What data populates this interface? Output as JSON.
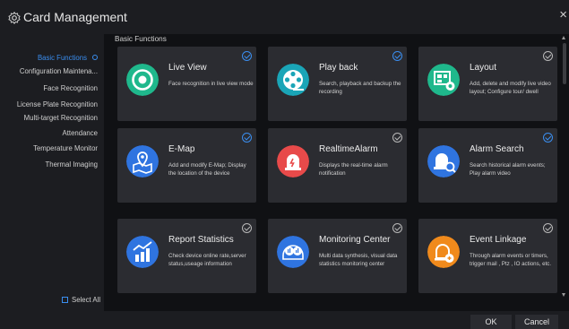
{
  "window": {
    "title": "Card Management",
    "close_symbol": "×"
  },
  "section": {
    "title": "Basic Functions"
  },
  "sidebar": {
    "items": [
      {
        "label": "Basic Functions",
        "active": true
      },
      {
        "label": "Configuration Maintena...",
        "active": false
      },
      {
        "label": "Face Recognition",
        "active": false
      },
      {
        "label": "License Plate Recognition",
        "active": false
      },
      {
        "label": "Multi-target Recognition",
        "active": false
      },
      {
        "label": "Attendance",
        "active": false
      },
      {
        "label": "Temperature Monitor",
        "active": false
      },
      {
        "label": "Thermal Imaging",
        "active": false
      }
    ],
    "select_all_label": "Select All"
  },
  "cards": [
    {
      "title": "Live View",
      "desc": "Face recognition in live view mode",
      "icon": "live-view-icon",
      "color": "#1fb88c",
      "checked": true
    },
    {
      "title": "Play back",
      "desc": "Search, playback and backup the recording",
      "icon": "playback-reel-icon",
      "color": "#1aa5b7",
      "checked": true
    },
    {
      "title": "Layout",
      "desc": "Add, delete and modify live video layout; Configure tour/ dwell",
      "icon": "layout-icon",
      "color": "#1fb88c",
      "checked": false
    },
    {
      "title": "E-Map",
      "desc": "Add and modify E-Map; Display the location of the device",
      "icon": "map-pin-icon",
      "color": "#2f74e0",
      "checked": true
    },
    {
      "title": "RealtimeAlarm",
      "desc": "Displays the real-time alarm notification",
      "icon": "alarm-bell-icon",
      "color": "#e84a4a",
      "checked": false
    },
    {
      "title": "Alarm Search",
      "desc": "Search historical alarm events; Play alarm video",
      "icon": "alarm-search-icon",
      "color": "#2f74e0",
      "checked": true
    },
    {
      "title": "Report Statistics",
      "desc": "Check device online rate,server status,useage information",
      "icon": "bar-chart-icon",
      "color": "#2f74e0",
      "checked": false
    },
    {
      "title": "Monitoring Center",
      "desc": "Multi data synthesis, visual data statistics monitoring center",
      "icon": "monitoring-center-icon",
      "color": "#2f74e0",
      "checked": false
    },
    {
      "title": "Event Linkage",
      "desc": "Through alarm events or timers, trigger mail , Ptz , IO actions, etc.",
      "icon": "event-linkage-icon",
      "color": "#f08a1c",
      "checked": false
    }
  ],
  "footer": {
    "ok_label": "OK",
    "cancel_label": "Cancel"
  }
}
